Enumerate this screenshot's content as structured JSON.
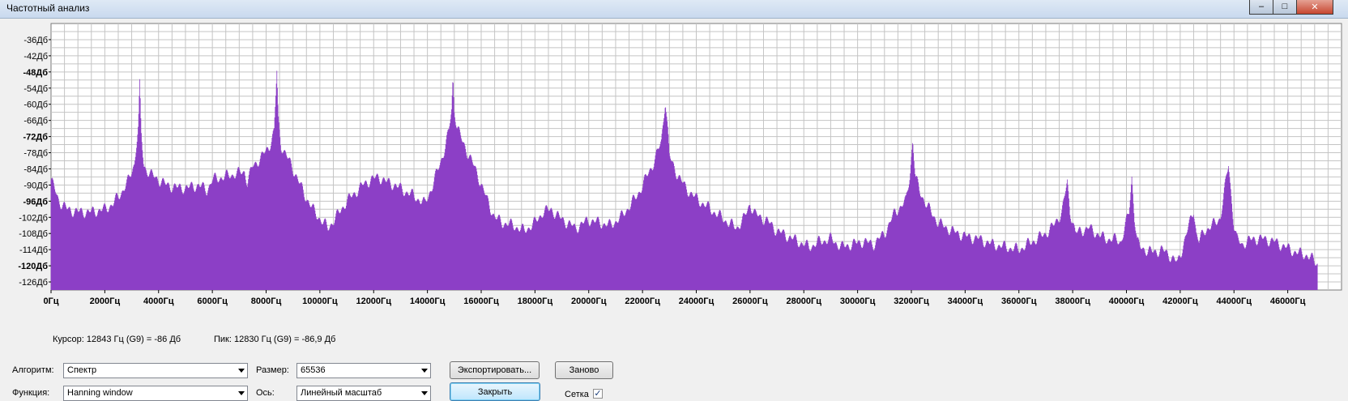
{
  "window": {
    "title": "Частотный анализ",
    "buttons": {
      "minimize": "–",
      "maximize": "□",
      "close": "✕"
    }
  },
  "chart_data": {
    "type": "area",
    "color": "#8c3fc6",
    "grid": true,
    "xlim": [
      0,
      48000
    ],
    "ylim": [
      -129,
      -30
    ],
    "y_ticks": [
      -36,
      -42,
      -48,
      -54,
      -60,
      -66,
      -72,
      -78,
      -84,
      -90,
      -96,
      -102,
      -108,
      -114,
      -120,
      -126
    ],
    "y_tick_labels": [
      "-36Дб",
      "-42Дб",
      "-48Дб",
      "-54Дб",
      "-60Дб",
      "-66Дб",
      "-72Дб",
      "-78Дб",
      "-84Дб",
      "-90Дб",
      "-96Дб",
      "-102Дб",
      "-108Дб",
      "-114Дб",
      "-120Дб",
      "-126Дб"
    ],
    "y_bold_ticks": [
      "-48Дб",
      "-72Дб",
      "-96Дб",
      "-120Дб"
    ],
    "x_ticks": [
      0,
      2000,
      4000,
      6000,
      8000,
      10000,
      12000,
      14000,
      16000,
      18000,
      20000,
      22000,
      24000,
      26000,
      28000,
      30000,
      32000,
      34000,
      36000,
      38000,
      40000,
      42000,
      44000,
      46000
    ],
    "x_tick_labels": [
      "0Гц",
      "2000Гц",
      "4000Гц",
      "6000Гц",
      "8000Гц",
      "10000Гц",
      "12000Гц",
      "14000Гц",
      "16000Гц",
      "18000Гц",
      "20000Гц",
      "22000Гц",
      "24000Гц",
      "26000Гц",
      "28000Гц",
      "30000Гц",
      "32000Гц",
      "34000Гц",
      "36000Гц",
      "38000Гц",
      "40000Гц",
      "42000Гц",
      "44000Гц",
      "46000Гц"
    ],
    "x": [
      0,
      300,
      600,
      1000,
      1500,
      2000,
      2300,
      2600,
      2900,
      3100,
      3250,
      3300,
      3350,
      3450,
      3700,
      4000,
      4300,
      4700,
      5100,
      5500,
      5800,
      6000,
      6400,
      6800,
      7200,
      7300,
      7500,
      7800,
      8100,
      8300,
      8400,
      8450,
      8550,
      8800,
      9100,
      9400,
      9800,
      10300,
      10600,
      10800,
      11000,
      11300,
      11600,
      11900,
      12200,
      12500,
      12800,
      13100,
      13500,
      13900,
      14200,
      14400,
      14600,
      14800,
      14900,
      14950,
      15000,
      15100,
      15300,
      15600,
      15900,
      16200,
      16500,
      16800,
      17200,
      17600,
      18000,
      18300,
      18600,
      18900,
      19200,
      19500,
      20000,
      20400,
      20800,
      21200,
      21500,
      21800,
      22100,
      22400,
      22700,
      22850,
      22950,
      23000,
      23100,
      23300,
      23600,
      24000,
      24400,
      24800,
      25200,
      25500,
      25800,
      26000,
      26200,
      26600,
      27000,
      27400,
      27800,
      28200,
      28600,
      29000,
      29400,
      29800,
      30200,
      30600,
      31000,
      31400,
      31800,
      31950,
      32050,
      32150,
      32300,
      32600,
      33000,
      33500,
      34000,
      34500,
      35000,
      35500,
      36000,
      36500,
      37000,
      37300,
      37600,
      37800,
      37900,
      38000,
      38100,
      38300,
      38600,
      38900,
      39200,
      39500,
      39800,
      40100,
      40200,
      40300,
      40400,
      40500,
      40700,
      41000,
      41300,
      41600,
      41900,
      42000,
      42300,
      42500,
      42600,
      42700,
      42900,
      43200,
      43500,
      43800,
      43950,
      44000,
      44100,
      44300,
      44700,
      45100,
      45500,
      45900,
      46300,
      46700,
      47100,
      47500,
      47900
    ],
    "y": [
      -88,
      -96,
      -99,
      -100,
      -100,
      -99,
      -97,
      -93,
      -88,
      -82,
      -68,
      -53,
      -70,
      -83,
      -86,
      -88,
      -90,
      -91,
      -91,
      -90,
      -92,
      -88,
      -87,
      -86,
      -85,
      -89,
      -83,
      -80,
      -76,
      -70,
      -48,
      -65,
      -75,
      -80,
      -86,
      -93,
      -100,
      -106,
      -102,
      -99,
      -96,
      -93,
      -90,
      -88,
      -87,
      -89,
      -90,
      -92,
      -94,
      -97,
      -90,
      -84,
      -78,
      -70,
      -62,
      -50,
      -62,
      -68,
      -74,
      -80,
      -87,
      -95,
      -102,
      -104,
      -105,
      -107,
      -104,
      -100,
      -99,
      -102,
      -104,
      -106,
      -103,
      -104,
      -105,
      -102,
      -98,
      -94,
      -88,
      -82,
      -74,
      -58,
      -71,
      -79,
      -82,
      -86,
      -91,
      -95,
      -98,
      -101,
      -104,
      -106,
      -102,
      -97,
      -101,
      -103,
      -107,
      -109,
      -111,
      -113,
      -111,
      -110,
      -113,
      -112,
      -111,
      -112,
      -108,
      -100,
      -96,
      -86,
      -73,
      -87,
      -92,
      -98,
      -104,
      -107,
      -109,
      -110,
      -112,
      -113,
      -114,
      -111,
      -108,
      -105,
      -100,
      -89,
      -100,
      -103,
      -108,
      -107,
      -106,
      -108,
      -110,
      -110,
      -111,
      -100,
      -87,
      -102,
      -111,
      -113,
      -114,
      -115,
      -114,
      -116,
      -119,
      -116,
      -106,
      -99,
      -108,
      -111,
      -107,
      -105,
      -102,
      -82,
      -100,
      -105,
      -110,
      -112,
      -110,
      -110,
      -111,
      -113,
      -115,
      -116,
      -119
    ]
  },
  "status": {
    "cursor": "Курсор: 12843 Гц (G9) = -86 Дб",
    "peak": "Пик: 12830 Гц (G9) = -86,9 Дб"
  },
  "controls": {
    "algorithm_label": "Алгоритм:",
    "algorithm_value": "Спектр",
    "size_label": "Размер:",
    "size_value": "65536",
    "function_label": "Функция:",
    "function_value": "Hanning window",
    "axis_label": "Ось:",
    "axis_value": "Линейный масштаб",
    "export_button": "Экспортировать...",
    "replot_button": "Заново",
    "close_button": "Закрыть",
    "grid_label": "Сетка",
    "grid_checked": true,
    "check_mark": "✓"
  }
}
